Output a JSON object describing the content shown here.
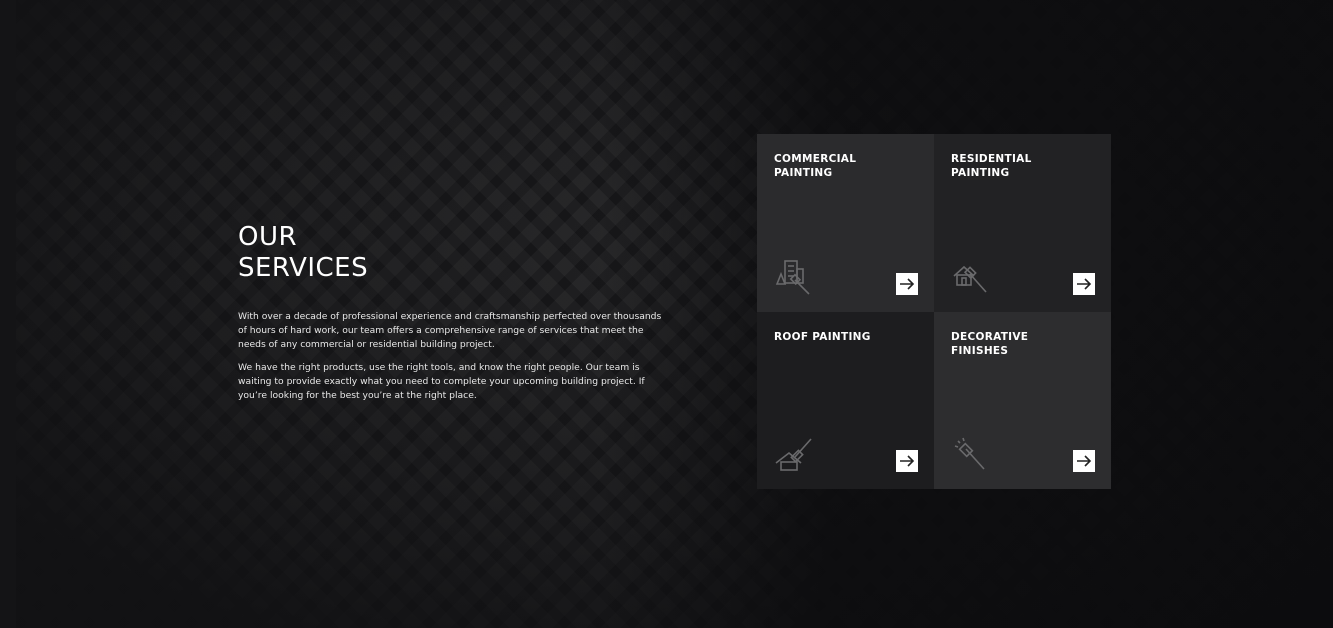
{
  "services_section": {
    "heading_line1": "OUR",
    "heading_line2": "SERVICES",
    "paragraph1": "With over a decade of professional experience and craftsmanship perfected over thousands of hours of hard work, our team offers a comprehensive range of services that meet the needs of any commercial or residential building project.",
    "paragraph2": "We have the right products, use the right tools, and know the right people. Our team is waiting to provide exactly what you need to complete your upcoming building project. If you’re looking for the best you’re at the right place."
  },
  "tiles": [
    {
      "title": "COMMERCIAL PAINTING",
      "icon": "commercial-building-brush-icon",
      "arrow_icon": "arrow-right-icon"
    },
    {
      "title": "RESIDENTIAL PAINTING",
      "icon": "house-brush-icon",
      "arrow_icon": "arrow-right-icon"
    },
    {
      "title": "ROOF PAINTING",
      "icon": "roof-roller-icon",
      "arrow_icon": "arrow-right-icon"
    },
    {
      "title": "DECORATIVE FINISHES",
      "icon": "decorative-brush-icon",
      "arrow_icon": "arrow-right-icon"
    }
  ],
  "colors": {
    "background": "#111113",
    "tile_light": "#2b2b2d",
    "tile_dark": "#1d1d1f",
    "text": "#ffffff",
    "icon_gray": "#6a6a6c"
  }
}
